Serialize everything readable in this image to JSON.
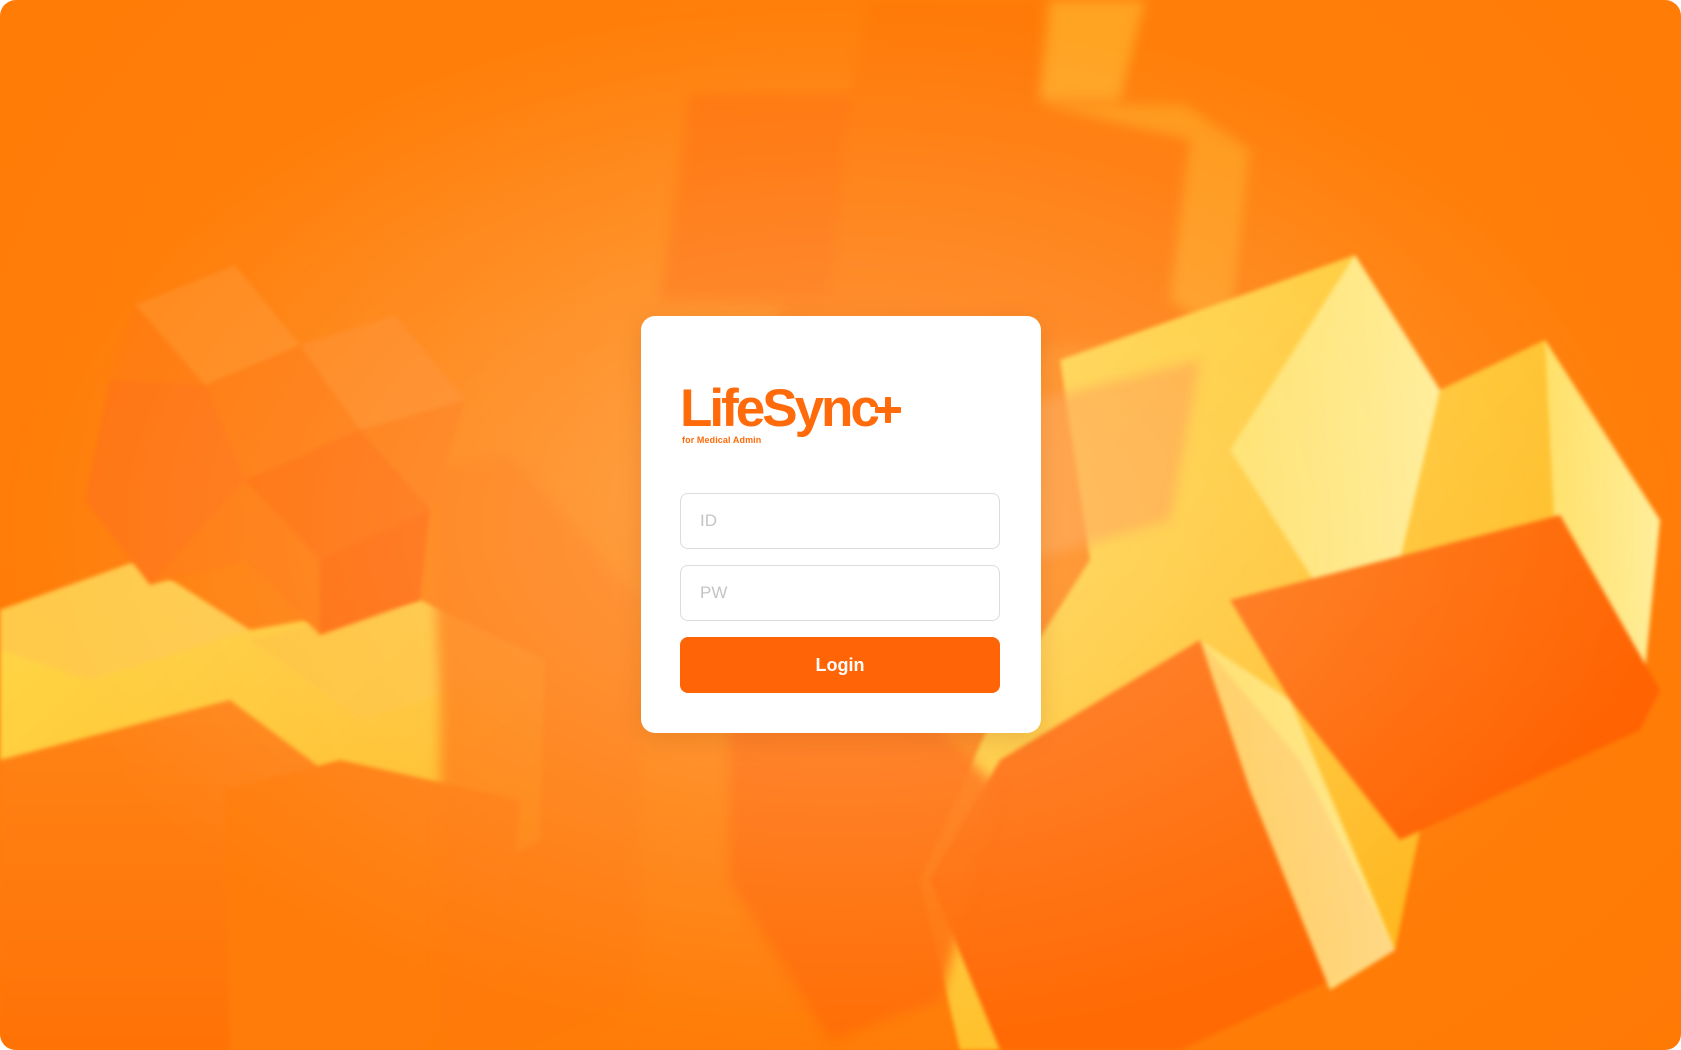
{
  "app": {
    "logo_text": "LifeSync",
    "logo_subtitle": "for Medical Admin"
  },
  "login": {
    "id_placeholder": "ID",
    "pw_placeholder": "PW",
    "button_label": "Login"
  },
  "icons": {
    "logo_plus": "plus-icon"
  },
  "colors": {
    "brand": "#ff6a0a",
    "button": "#ff6506",
    "background": "#ff7f0a",
    "card": "#ffffff"
  }
}
